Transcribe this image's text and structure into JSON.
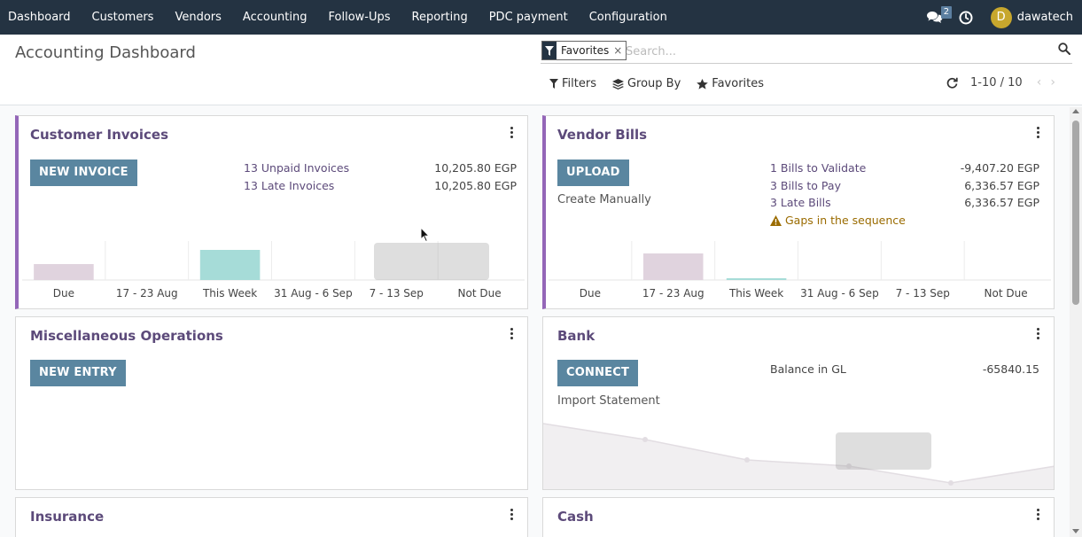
{
  "nav": {
    "items": [
      "Dashboard",
      "Customers",
      "Vendors",
      "Accounting",
      "Follow-Ups",
      "Reporting",
      "PDC payment",
      "Configuration"
    ],
    "messages_badge": "2",
    "avatar_letter": "D",
    "username": "dawatech"
  },
  "control": {
    "title": "Accounting Dashboard",
    "facet_label": "Favorites",
    "facet_close": "×",
    "search_placeholder": "Search...",
    "filters_label": "Filters",
    "groupby_label": "Group By",
    "favorites_label": "Favorites",
    "pager_value": "1-10 / 10",
    "pager_prev": "‹",
    "pager_next": "›"
  },
  "cards": {
    "customer_invoices": {
      "title": "Customer Invoices",
      "button": "NEW INVOICE",
      "stats": [
        {
          "label": "13 Unpaid Invoices",
          "value": "10,205.80 EGP"
        },
        {
          "label": "13 Late Invoices",
          "value": "10,205.80 EGP"
        }
      ],
      "chart_categories": [
        "Due",
        "17 - 23 Aug",
        "This Week",
        "31 Aug - 6 Sep",
        "7 - 13 Sep",
        "Not Due"
      ],
      "chart_values": [
        0.45,
        0,
        0.85,
        0,
        0,
        0
      ],
      "chart_colors": [
        "#e0d3de",
        "#e0d3de",
        "#a6dcd8",
        "#e0d3de",
        "#e0d3de",
        "#e0d3de"
      ]
    },
    "vendor_bills": {
      "title": "Vendor Bills",
      "button": "UPLOAD",
      "secondary": "Create Manually",
      "stats": [
        {
          "label": "1 Bills to Validate",
          "value": "-9,407.20 EGP"
        },
        {
          "label": "3 Bills to Pay",
          "value": "6,336.57 EGP"
        },
        {
          "label": "3 Late Bills",
          "value": "6,336.57 EGP"
        }
      ],
      "warning": "Gaps in the sequence",
      "chart_categories": [
        "Due",
        "17 - 23 Aug",
        "This Week",
        "31 Aug - 6 Sep",
        "7 - 13 Sep",
        "Not Due"
      ],
      "chart_values": [
        0,
        0.75,
        0.05,
        0,
        0,
        0
      ],
      "chart_colors": [
        "#e0d3de",
        "#e0d3de",
        "#a6dcd8",
        "#e0d3de",
        "#e0d3de",
        "#e0d3de"
      ]
    },
    "misc": {
      "title": "Miscellaneous Operations",
      "button": "NEW ENTRY"
    },
    "bank": {
      "title": "Bank",
      "button": "CONNECT",
      "secondary": "Import Statement",
      "balance_label": "Balance in GL",
      "balance_value": "-65840.15"
    },
    "insurance": {
      "title": "Insurance"
    },
    "cash": {
      "title": "Cash"
    }
  },
  "colors": {
    "navbar": "#243342",
    "accent": "#9466b8",
    "button": "#5a86a0",
    "warning": "#9a6b00"
  }
}
